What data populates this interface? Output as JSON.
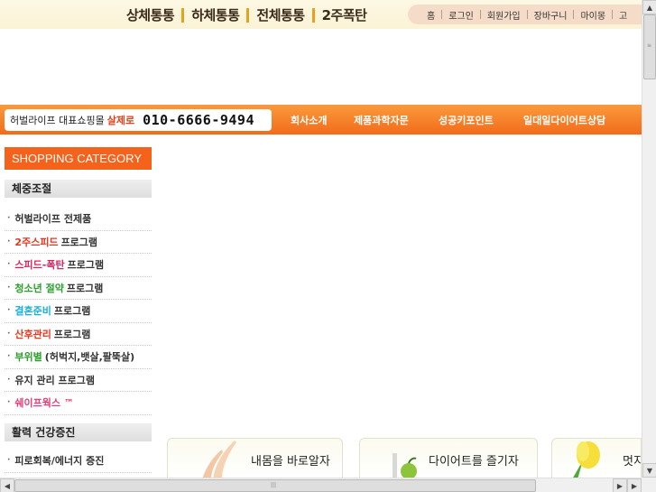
{
  "promo_nav": [
    "상체통통",
    "하체통통",
    "전체통통",
    "2주폭탄"
  ],
  "util_nav": [
    "홈",
    "로그인",
    "회원가입",
    "장바구니",
    "마이몽",
    "고"
  ],
  "phone_box": {
    "label": "허벌라이프 대표쇼핑몰",
    "highlight": "살제로",
    "phone": "010-6666-9494"
  },
  "main_nav": [
    "회사소개",
    "제품과학자문",
    "성공키포인트",
    "일대일다이어트상담"
  ],
  "category_header": "SHOPPING CATEGORY",
  "section1": {
    "title": "체중조절",
    "items": [
      {
        "hl": "",
        "text": "허벌라이프 전제품",
        "color": "#333333"
      },
      {
        "hl": "2주스피드",
        "text": "프로그램",
        "color": "#e8361c"
      },
      {
        "hl": "스피드-폭탄",
        "text": "프로그램",
        "color": "#e0205a"
      },
      {
        "hl": "청소년 절약",
        "text": "프로그램",
        "color": "#2ca02c"
      },
      {
        "hl": "결혼준비",
        "text": "프로그램",
        "color": "#1ab0d8"
      },
      {
        "hl": "산후관리",
        "text": "프로그램",
        "color": "#e8361c"
      },
      {
        "hl": "부위별",
        "text": "(허벅지,뱃살,팔뚝살)",
        "color": "#2ca02c"
      },
      {
        "hl": "",
        "text": "유지 관리 프로그램",
        "color": "#333333"
      },
      {
        "hl": "쉐이프웍스 ™",
        "text": "",
        "color": "#e0407a"
      }
    ]
  },
  "section2": {
    "title": "활력 건강증진",
    "items": [
      {
        "hl": "",
        "text": "피로회복/에너지 증진",
        "color": "#333333"
      }
    ]
  },
  "banners": [
    "내몸을 바로알자",
    "다이어트를 즐기자",
    "멋지"
  ]
}
